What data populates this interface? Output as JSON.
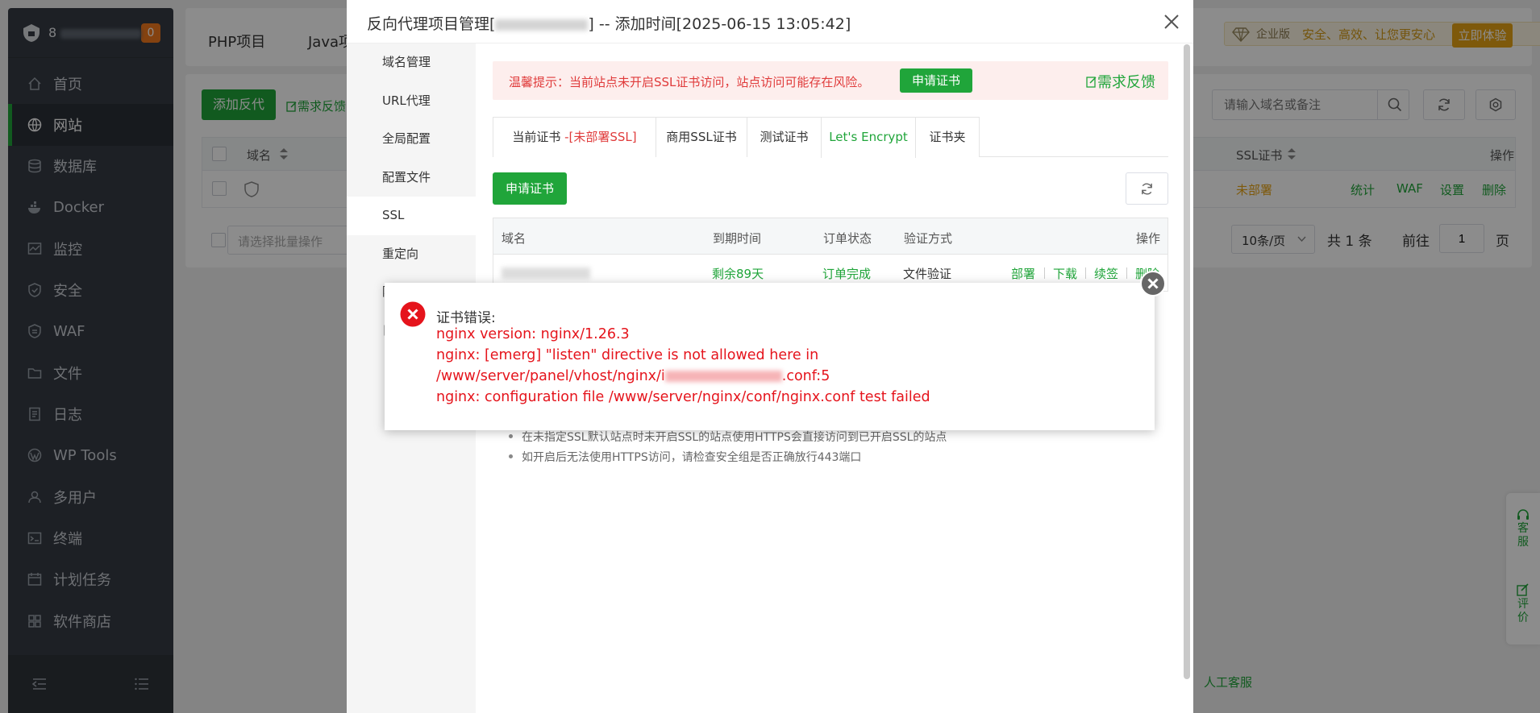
{
  "sidebar": {
    "host_prefix": "8",
    "badge": "0",
    "items": [
      {
        "label": "首页",
        "icon": "home-icon"
      },
      {
        "label": "网站",
        "icon": "globe-icon",
        "active": true
      },
      {
        "label": "数据库",
        "icon": "database-icon"
      },
      {
        "label": "Docker",
        "icon": "docker-icon"
      },
      {
        "label": "监控",
        "icon": "monitor-icon"
      },
      {
        "label": "安全",
        "icon": "shield-icon"
      },
      {
        "label": "WAF",
        "icon": "waf-icon"
      },
      {
        "label": "文件",
        "icon": "folder-icon"
      },
      {
        "label": "日志",
        "icon": "log-icon"
      },
      {
        "label": "WP Tools",
        "icon": "wordpress-icon"
      },
      {
        "label": "多用户",
        "icon": "users-icon"
      },
      {
        "label": "终端",
        "icon": "terminal-icon"
      },
      {
        "label": "计划任务",
        "icon": "calendar-icon"
      },
      {
        "label": "软件商店",
        "icon": "apps-icon"
      }
    ]
  },
  "topbar": {
    "tab_php": "PHP项目",
    "tab_java": "Java项",
    "enterprise_label": "企业版",
    "enterprise_slogan": "安全、高效、让您更安心",
    "try_button": "立即体验"
  },
  "website": {
    "add_button": "添加反代",
    "feedback": "需求反馈",
    "search_placeholder": "请输入域名或备注",
    "col_domain": "域名",
    "col_ssl": "SSL证书",
    "col_ops": "操作",
    "row_ssl_status": "未部署",
    "row_ops": [
      "统计",
      "WAF",
      "设置",
      "删除"
    ],
    "batch_placeholder": "请选择批量操作",
    "page_size": "10条/页",
    "total": "共 1 条",
    "goto": "前往",
    "page_value": "1",
    "page_unit": "页",
    "float_service": "客服",
    "float_rate": "评价",
    "human_service": "人工客服"
  },
  "dialog": {
    "title_prefix": "反向代理项目管理[",
    "title_suffix": "] -- 添加时间[2025-06-15 13:05:42]",
    "nav": [
      "域名管理",
      "URL代理",
      "全局配置",
      "配置文件",
      "SSL",
      "重定向",
      "隐",
      "日"
    ],
    "nav_active": "SSL",
    "warning": "温馨提示：当前站点未开启SSL证书访问，站点访问可能存在风险。",
    "warning_button": "申请证书",
    "warning_feedback": "需求反馈",
    "tabs": {
      "current": "当前证书",
      "current_status": "-[未部署SSL]",
      "commercial": "商用SSL证书",
      "test": "测试证书",
      "letsencrypt": "Let's Encrypt",
      "folder": "证书夹"
    },
    "apply_button": "申请证书",
    "cert_table": {
      "headers": [
        "域名",
        "到期时间",
        "订单状态",
        "验证方式",
        "操作"
      ],
      "row": {
        "expire": "剩余89天",
        "status": "订单完成",
        "verify": "文件验证",
        "ops": [
          "部署",
          "下载",
          "续签",
          "删除"
        ]
      }
    },
    "notes": [
      "在未指定SSL默认站点时未开启SSL的站点使用HTTPS会直接访问到已开启SSL的站点",
      "如开启后无法使用HTTPS访问，请检查安全组是否正确放行443端口"
    ]
  },
  "error": {
    "title": "证书错误:",
    "line1": "nginx version: nginx/1.26.3",
    "line2": "nginx: [emerg] \"listen\" directive is not allowed here in",
    "line3_prefix": "/www/server/panel/vhost/nginx/i",
    "line3_suffix": ".conf:5",
    "line4": "nginx: configuration file /www/server/nginx/conf/nginx.conf test failed"
  },
  "colors": {
    "accent": "#20a53a",
    "error": "#e5141c",
    "sidebar": "#353b44",
    "warning_bg": "#fdeeed"
  }
}
